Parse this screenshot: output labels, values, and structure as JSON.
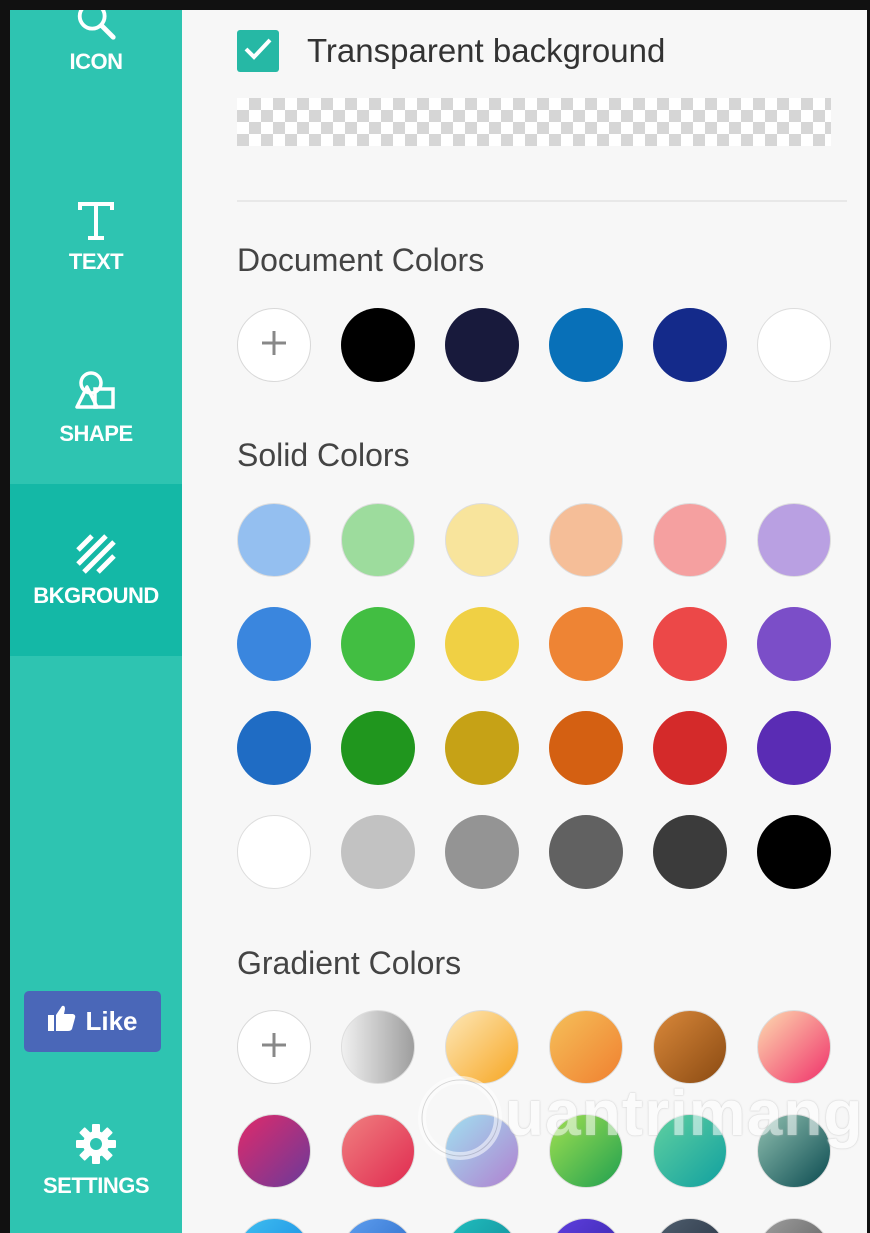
{
  "sidebar": {
    "items": [
      {
        "label": "ICON",
        "icon": "search-icon"
      },
      {
        "label": "TEXT",
        "icon": "text-t-icon"
      },
      {
        "label": "SHAPE",
        "icon": "shape-icon"
      },
      {
        "label": "BKGROUND",
        "icon": "stripes-icon",
        "active": true
      }
    ],
    "like_label": "Like",
    "settings_label": "SETTINGS",
    "color": "#2ec4b1",
    "active_color": "#14b8a6"
  },
  "panel": {
    "transparent_label": "Transparent background",
    "transparent_checked": true,
    "document_colors_title": "Document Colors",
    "document_colors": [
      "#000000",
      "#181a3c",
      "#0870b8",
      "#142a8a",
      "#ffffff"
    ],
    "solid_colors_title": "Solid Colors",
    "solid_colors": [
      [
        "#94bff0",
        "#9ddc9d",
        "#f8e49c",
        "#f5be98",
        "#f5a0a0",
        "#b9a0e2"
      ],
      [
        "#3a86de",
        "#42be42",
        "#f0d044",
        "#ee8434",
        "#ec4848",
        "#7b4ec8"
      ],
      [
        "#1f6cc4",
        "#20961e",
        "#c6a216",
        "#d46012",
        "#d42a2a",
        "#5a2cb4"
      ],
      [
        "#ffffff",
        "#c2c2c2",
        "#949494",
        "#616161",
        "#3b3b3b",
        "#000000"
      ]
    ],
    "gradient_colors_title": "Gradient Colors",
    "gradient_colors": [
      [
        "#f0f0f0,#9e9e9e",
        "#fde8b8,#f7a623",
        "#f5c05a,#f08030",
        "#d9883a,#8a4a12",
        "#fddcb0,#f0306a"
      ],
      [
        "#e02a6a,#6a3a9a",
        "#f08080,#e02a50",
        "#a0e0f0,#b080d0",
        "#a0e050,#20a050",
        "#60d0a0,#10a0a0",
        "#90c0b0,#0a4a50"
      ],
      [
        "#40c0f0,#1080e0",
        "#60a0f0,#2060c0",
        "#20c0c0,#108090",
        "#6040e0,#3020a0",
        "#506070,#202838",
        "#a0a0a0,#505050"
      ]
    ]
  },
  "watermark_text": "uantrimang"
}
